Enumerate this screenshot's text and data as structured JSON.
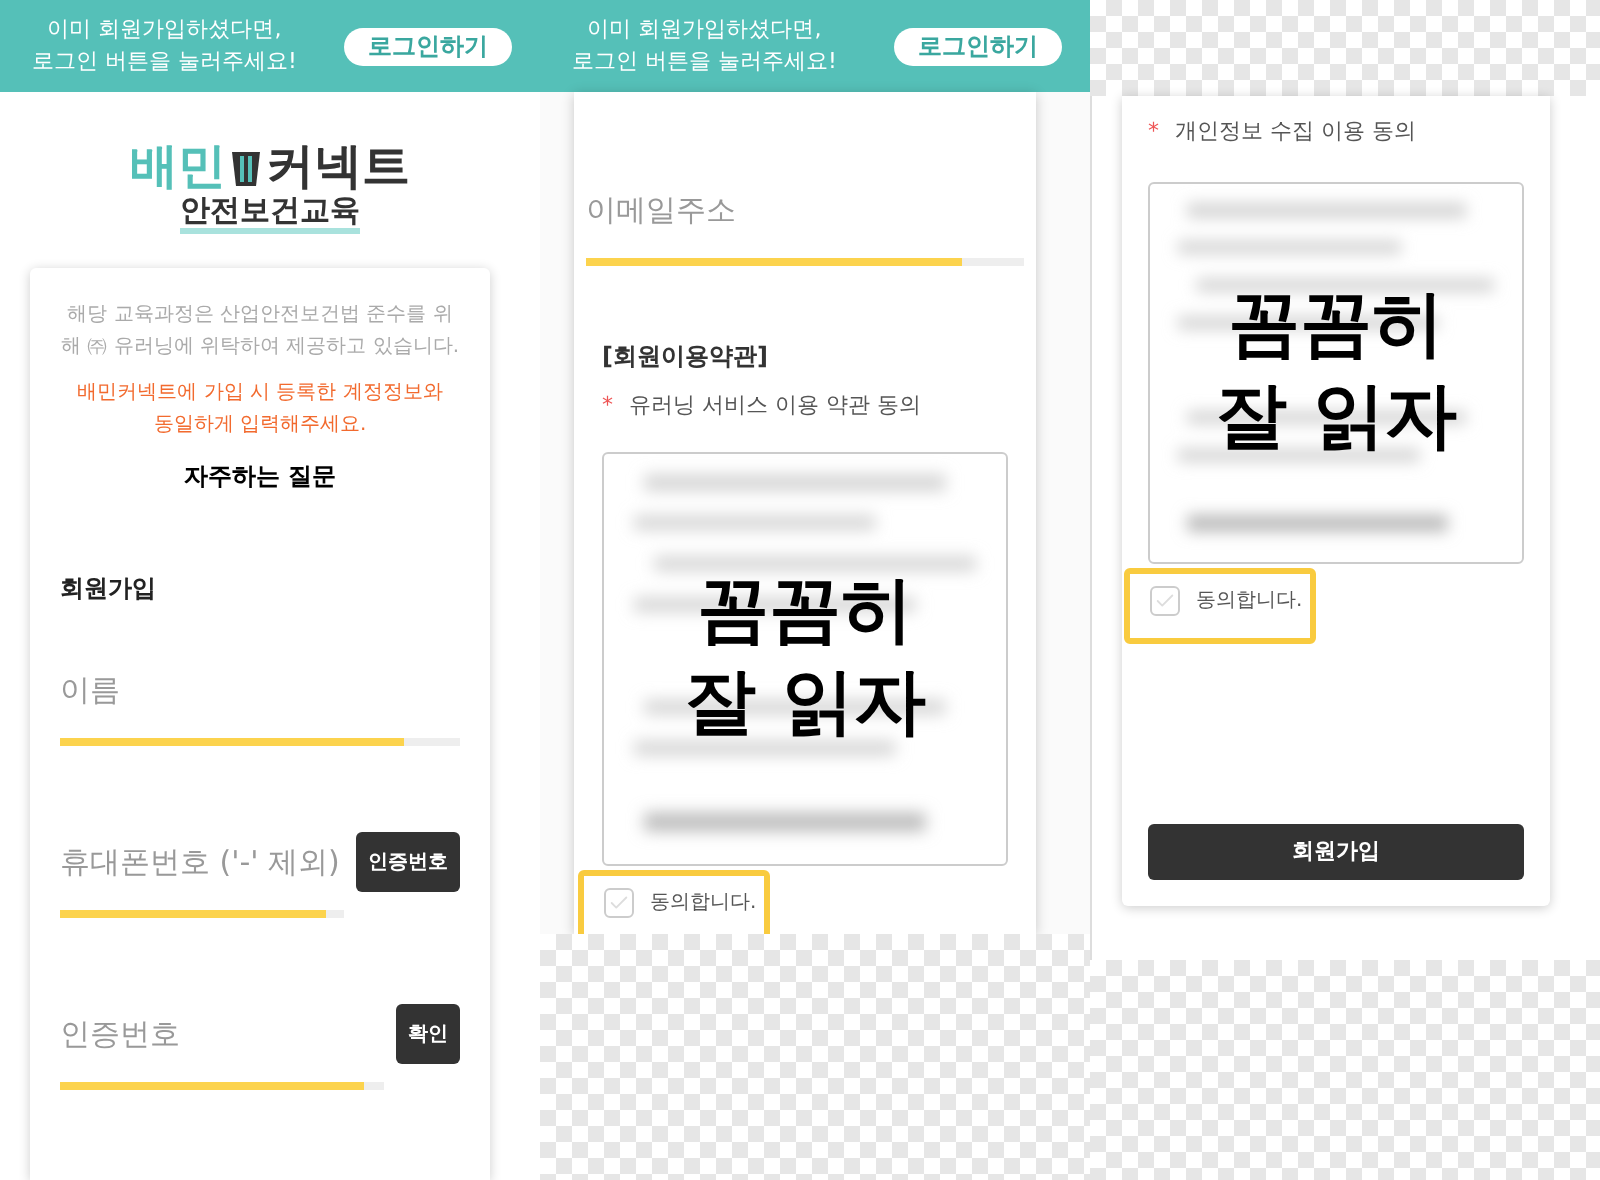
{
  "left_screen": {
    "banner": {
      "lines": [
        "이미 회원가입하셨다면,",
        "로그인 버튼을 눌러주세요!"
      ],
      "button": "로그인하기"
    },
    "logo": {
      "part_1": "배민",
      "part_2": "커넥트",
      "subtitle": "안전보건교육"
    },
    "notice": "해당 교육과정은 산업안전보건법 준수를 위해 ㈜ 유러닝에 위탁하여 제공하고 있습니다.",
    "warning_lines": [
      "배민커넥트에 가입 시 등록한 계정정보와",
      "동일하게 입력해주세요."
    ],
    "faq_link": "자주하는 질문",
    "section_title": "회원가입",
    "fields": [
      {
        "placeholder": "이름"
      },
      {
        "placeholder": "휴대폰번호 ('-' 제외)",
        "button": "인증번호"
      },
      {
        "placeholder": "인증번호",
        "button": "확인"
      }
    ]
  },
  "middle_screen": {
    "banner": {
      "lines": [
        "이미 회원가입하셨다면,",
        "로그인 버튼을 눌러주세요!"
      ],
      "button": "로그인하기"
    },
    "fields": [
      {
        "placeholder": "이메일주소"
      }
    ],
    "terms": {
      "title": "[회원이용약관]",
      "required_mark": "*",
      "label": "유러닝 서비스 이용 약관 동의",
      "overlay_lines": [
        "꼼꼼히",
        "잘 읽자"
      ],
      "agree": {
        "label": "동의합니다.",
        "checked": false,
        "highlighted": true
      }
    }
  },
  "right_screen": {
    "terms": {
      "required_mark": "*",
      "label": "개인정보 수집 이용 동의",
      "overlay_lines": [
        "꼼꼼히",
        "잘 읽자"
      ],
      "agree": {
        "label": "동의합니다.",
        "checked": false,
        "highlighted": true
      }
    },
    "submit_button": "회원가입"
  }
}
